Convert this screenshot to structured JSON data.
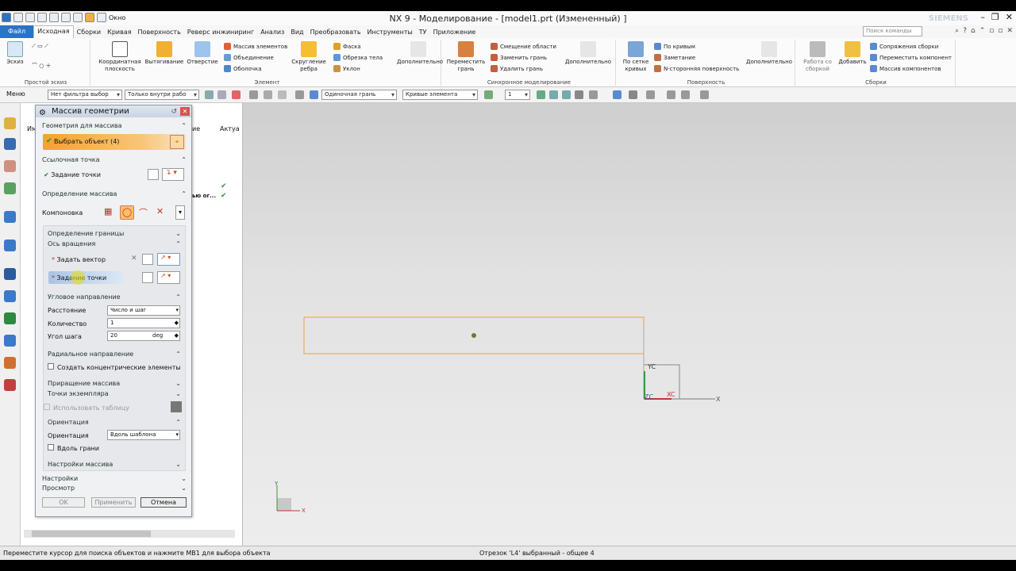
{
  "app": {
    "title": "NX 9 - Моделирование - [model1.prt (Измененный) ]",
    "brand": "SIEMENS",
    "window_menu": "Окно"
  },
  "menubar": {
    "file": "Файл",
    "items": [
      "Исходная",
      "Сборки",
      "Кривая",
      "Поверхность",
      "Реверс инжиниринг",
      "Анализ",
      "Вид",
      "Преобразовать",
      "Инструменты",
      "ТУ",
      "Приложение"
    ],
    "search_placeholder": "Поиск команды"
  },
  "ribbon": {
    "sketch_group": {
      "label": "Простой эскиз",
      "sketch": "Эскиз"
    },
    "element_group": {
      "label": "Элемент",
      "datum_plane": "Координатная плоскость",
      "extrude": "Вытягивание",
      "hole": "Отверстие",
      "pattern": "Массив элементов",
      "unite": "Объединение",
      "shell": "Оболочка",
      "edge_blend": "Скругление ребра",
      "chamfer": "Фаска",
      "trim_body": "Обрезка тела",
      "draft": "Уклон",
      "more": "Дополнительно"
    },
    "sync_group": {
      "label": "Синхронное моделирование",
      "move_face": "Переместить грань",
      "offset_region": "Смещение области",
      "replace_face": "Заменить грань",
      "delete_face": "Удалить грань",
      "more": "Дополнительно"
    },
    "surface_group": {
      "label": "Поверхность",
      "through_curve_mesh": "По сетке кривых",
      "through_curves": "По кривым",
      "swept": "Заметание",
      "n_sided": "N-сторонняя поверхность",
      "more": "Дополнительно"
    },
    "assembly_group": {
      "label": "Сборки",
      "work_assembly": "Работа со сборкой",
      "add": "Добавить",
      "constraints": "Сопряжения сборки",
      "move_component": "Переместить компонент",
      "component_pattern": "Массив компонентов"
    }
  },
  "toolbar2": {
    "menu": "Меню",
    "filter": "Нет фильтра выбор",
    "scope": "Только внутри рабо",
    "face_rule": "Одиночная грань",
    "curve_rule": "Кривые элемента",
    "count": "1"
  },
  "navigator": {
    "col1": "Им",
    "col2": "ие",
    "col3": "Актуа",
    "item": "ью ог..."
  },
  "dialog": {
    "title": "Массив геометрии",
    "geom_section": "Геометрия для массива",
    "select_object": "Выбрать объект (4)",
    "ref_point_section": "Ссылочная точка",
    "specify_point": "Задание точки",
    "pattern_def_section": "Определение массива",
    "layout_label": "Компоновка",
    "boundary_def": "Определение границы",
    "rotation_axis": "Ось вращения",
    "specify_vector": "Задать вектор",
    "specify_point2": "Задание точки",
    "angular_dir": "Угловое направление",
    "spacing_label": "Расстояние",
    "spacing_value": "Число и шаг",
    "count_label": "Количество",
    "count_value": "1",
    "pitch_label": "Угол шага",
    "pitch_value": "20",
    "pitch_unit": "deg",
    "radial_dir": "Радиальное направление",
    "concentric": "Создать концентрические элементы",
    "pattern_increment": "Приращение массива",
    "instance_points": "Точки экземпляра",
    "use_table": "Использовать таблицу",
    "orientation_section": "Ориентация",
    "orientation_label": "Ориентация",
    "orientation_value": "Вдоль шаблона",
    "along_face": "Вдоль грани",
    "pattern_settings": "Настройки массива",
    "settings": "Настройки",
    "preview": "Просмотр",
    "ok": "OK",
    "apply": "Применить",
    "cancel": "Отмена"
  },
  "viewport": {
    "yc": "YC",
    "xc": "XC",
    "zc": "ZC",
    "x": "X",
    "y": "Y"
  },
  "status": {
    "left": "Переместите курсор для поиска объектов и нажмите MB1 для выбора объекта",
    "right": "Отрезок 'L4' выбранный - общее 4"
  },
  "colors": {
    "accent": "#f4a22c",
    "file_blue": "#2a73c5",
    "rect_outline": "#f0a040"
  }
}
